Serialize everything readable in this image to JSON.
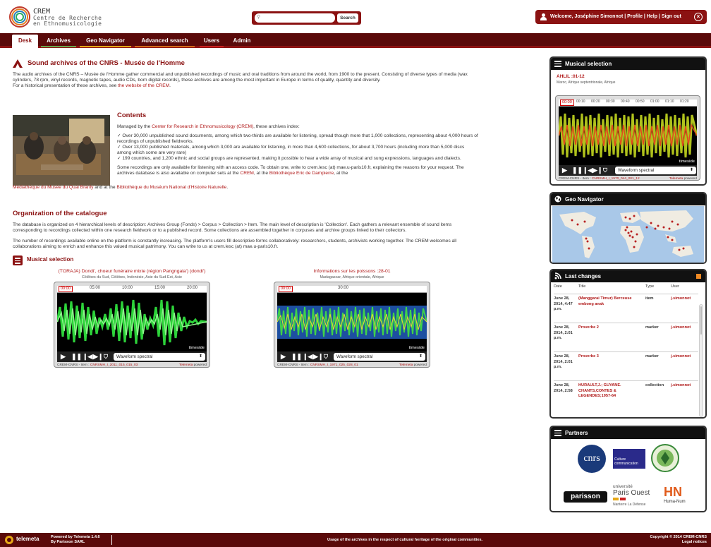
{
  "header": {
    "logo_title": "CREM",
    "logo_line1": "Centre de Recherche",
    "logo_line2": "en Ethnomusicologie",
    "search_placeholder": "",
    "search_button": "Search",
    "user_text": "Welcome, Joséphine Simonnot | Profile | Help | Sign out"
  },
  "nav": {
    "tabs": [
      {
        "label": "Desk",
        "color": "#ffffff"
      },
      {
        "label": "Archives",
        "color": "#6aa84f"
      },
      {
        "label": "Geo Navigator",
        "color": "#e6a817"
      },
      {
        "label": "Advanced search",
        "color": "#d46a1a"
      },
      {
        "label": "Users",
        "color": "#cc2222"
      },
      {
        "label": "Admin",
        "color": "#8b1212"
      }
    ]
  },
  "main": {
    "title": "Sound archives of the CNRS - Musée de l'Homme",
    "intro": "The audio archives of the CNRS – Musée de l'Homme gather commercial and unpublished recordings of music and oral traditions from around the world, from 1900 to the present. Consisting of diverse types of media (wax cylinders, 78 rpm, vinyl records, magnetic tapes, audio CDs, born digital records), these archives are among the most important in Europe in terms of quality, quantity and diversity.",
    "intro2_pre": "For a historical presentation of these archives, see ",
    "intro2_link": "the website of the CREM",
    "intro2_post": ".",
    "contents_title": "Contents",
    "contents_p1_pre": "Managed by the ",
    "contents_p1_link": "Center for Research in Ethnomusicology (CREM)",
    "contents_p1_post": ", these archives index:",
    "bullet1": "✓ Over 30,000 unpublished sound documents, among which two-thirds are available for listening, spread though more that 1,000 collections, representing about 4,000 hours of recordings of unpublished fieldworks.",
    "bullet2": "✓ Over 13,000 published materials, among which 3,000 are available for listening, in more than 4,600 collections, for about 3,700 hours (including more than 5,000 discs among which some are very rare)",
    "bullet3": "✓ 199 countries, and 1,200 ethnic and social groups are represented, making it possible to hear a wide array of musical and sung expressions, languages and dialects.",
    "access_p": "Some recordings are only available for listening with an access code. To obtain one, write to crem.lesc (at) mae.u-paris10.fr, explaining the reasons for your request. The archives database is also available on computer sets at the ",
    "access_l1": "CREM",
    "access_m1": ", at the ",
    "access_l2": "Bibliothèque Eric de Dampierre",
    "access_m2": ", at the ",
    "access_l3": "Médiathèque du Musée du Quai Branly",
    "access_m3": " and at the ",
    "access_l4": "Bibliothèque du Muséum National d'Histoire Naturelle",
    "access_end": ".",
    "org_title": "Organization of the catalogue",
    "org_p1": "The database is organized on 4 hierarchical levels of description: Archives Group (Fonds) > Corpus > Collection > Item. The main level of description is 'Collection'. Each gathers a relevant ensemble of sound items corresponding to recordings collected within one research fieldwork or to a published record. Some collections are assembled together in corpuses and archive groups linked to their collectors.",
    "org_p2": "The number of recordings available online on the platform is constantly increasing. The platform's users fill descriptive forms collaboratively: researchers, students, archivists working together. The CREM welcomes all collaborations aiming to enrich and enhance this valued musical patrimony. You can write to us at crem.lesc (at) mae.u-paris10.fr.",
    "ms_title": "Musical selection"
  },
  "players": [
    {
      "title": "(TORAJA) Dondi', choeur funéraire mixte (région Pangngala') (dondi')",
      "subtitle": "Célèbes du Sud, Célèbes, Indonésie, Asie du Sud-Est, Asie",
      "timecode": "00:00",
      "ticks": [
        "05:00",
        "10:00",
        "15:00",
        "20:00"
      ],
      "select": "Waveform spectral",
      "brand": "timeside",
      "foot_left_pre": "CREM-CNRS - Item : ",
      "foot_left_link": "CNRSMH_I_2011_015_015_03",
      "foot_right_link": "Telemeta",
      "foot_right_post": " powered"
    },
    {
      "title": "Informations sur les poissons :28-01",
      "subtitle": "Madagascar, Afrique orientale, Afrique",
      "timecode": "00:00",
      "ticks": [
        "30:00"
      ],
      "select": "Waveform spectral",
      "brand": "timeside",
      "foot_left_pre": "CREM-CNRS - Item : ",
      "foot_left_link": "CNRSMH_I_1971_025_028_01",
      "foot_right_link": "Telemeta",
      "foot_right_post": " powered"
    }
  ],
  "sidebar": {
    "ms": {
      "header": "Musical selection",
      "title": "AHLIL :01-12",
      "subtitle": "Maroc, Afrique septentrionale, Afrique",
      "timecode": "00:00",
      "ticks": [
        "00:10",
        "00:20",
        "00:30",
        "00:40",
        "00:50",
        "01:00",
        "01:10",
        "01:20"
      ],
      "select": "Waveform spectral",
      "brand": "timeside",
      "foot_left_pre": "CREM-CNRS - Item : ",
      "foot_left_link": "CNRSMH_I_1970_044_001_12",
      "foot_right_link": "Telemeta",
      "foot_right_post": " powered"
    },
    "geo": {
      "header": "Geo Navigator"
    },
    "lc": {
      "header": "Last changes",
      "cols": [
        "Date",
        "Title",
        "Type",
        "User"
      ],
      "rows": [
        {
          "date": "June 28, 2014, 4:47 p.m.",
          "title": "(Manggarai Timur) Berceuse embong anak",
          "type": "item",
          "user": "j.simonnot"
        },
        {
          "date": "June 28, 2014, 2:01 p.m.",
          "title": "Proverbe 2",
          "type": "marker",
          "user": "j.simonnot"
        },
        {
          "date": "June 28, 2014, 2:01 p.m.",
          "title": "Proverbe 3",
          "type": "marker",
          "user": "j.simonnot"
        },
        {
          "date": "June 28, 2014, 2:58",
          "title": "HURAULT,J.; GUYANE. CHANTS,CONTES & LEGENDES;1957-64",
          "type": "collection",
          "user": "j.simonnot"
        }
      ]
    },
    "pt": {
      "header": "Partners",
      "cnrs": "cnrs",
      "culture": "Culture communication",
      "parisson": "parisson",
      "univ1": "université",
      "univ2": "Paris Ouest",
      "univ3": "Nanterre La Défense",
      "huma": "Huma-Num"
    }
  },
  "footer": {
    "logo": "telemeta",
    "powered_pre": "Powered by ",
    "powered_name": "Telemeta 1.4.6",
    "by": "By Parisson SARL",
    "middle": "Usage of the archives in the respect of cultural heritage of the original communities.",
    "copyright": "Copyright © 2014 CREM-CNRS",
    "legal": "Legal notices"
  }
}
